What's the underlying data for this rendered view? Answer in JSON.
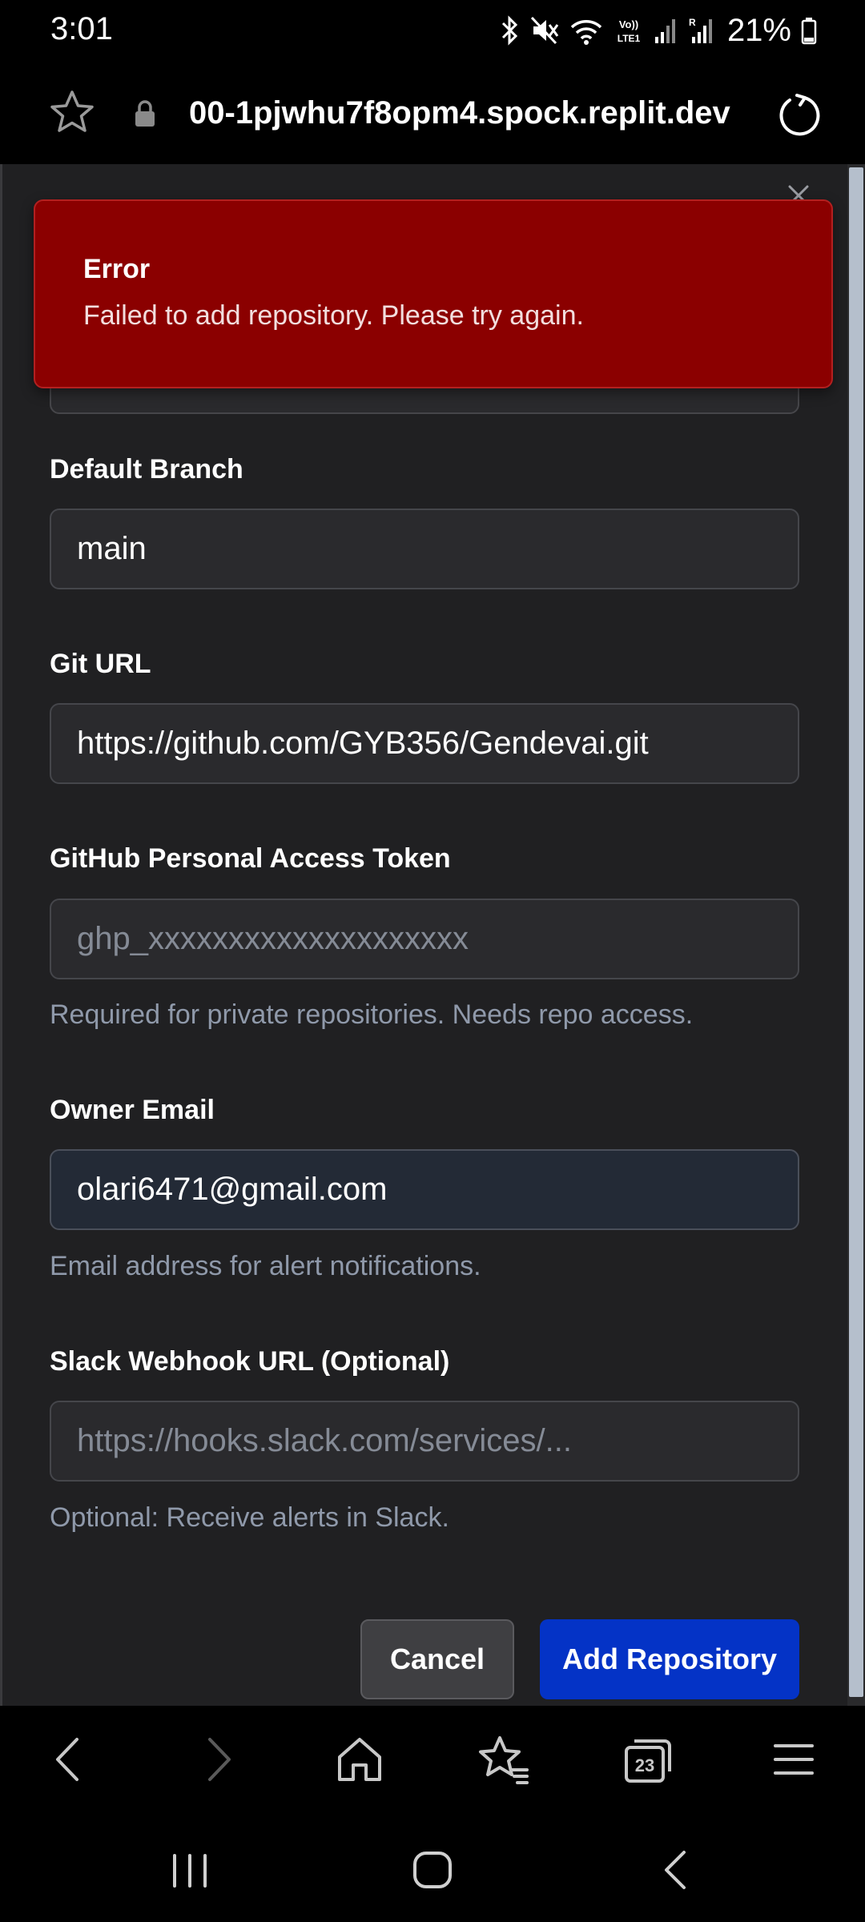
{
  "status_bar": {
    "time": "3:01",
    "battery": "21%",
    "icons": [
      "bluetooth-icon",
      "mute-icon",
      "wifi-icon",
      "volte-icon",
      "signal-icon",
      "signal-r-icon",
      "battery-icon"
    ]
  },
  "browser": {
    "url": "00-1pjwhu7f8opm4.spock.replit.dev",
    "tab_count": "23"
  },
  "error_toast": {
    "title": "Error",
    "message": "Failed to add repository. Please try again.",
    "background": "#8b0000"
  },
  "form": {
    "default_branch": {
      "label": "Default Branch",
      "value": "main"
    },
    "git_url": {
      "label": "Git URL",
      "value": "https://github.com/GYB356/Gendevai.git"
    },
    "token": {
      "label": "GitHub Personal Access Token",
      "placeholder": "ghp_xxxxxxxxxxxxxxxxxxxx",
      "hint": "Required for private repositories. Needs repo access."
    },
    "owner_email": {
      "label": "Owner Email",
      "value": "olari6471@gmail.com",
      "hint": "Email address for alert notifications."
    },
    "slack": {
      "label": "Slack Webhook URL (Optional)",
      "placeholder": "https://hooks.slack.com/services/...",
      "hint": "Optional: Receive alerts in Slack."
    }
  },
  "actions": {
    "cancel_label": "Cancel",
    "add_label": "Add Repository",
    "accent": "#0433c6"
  }
}
